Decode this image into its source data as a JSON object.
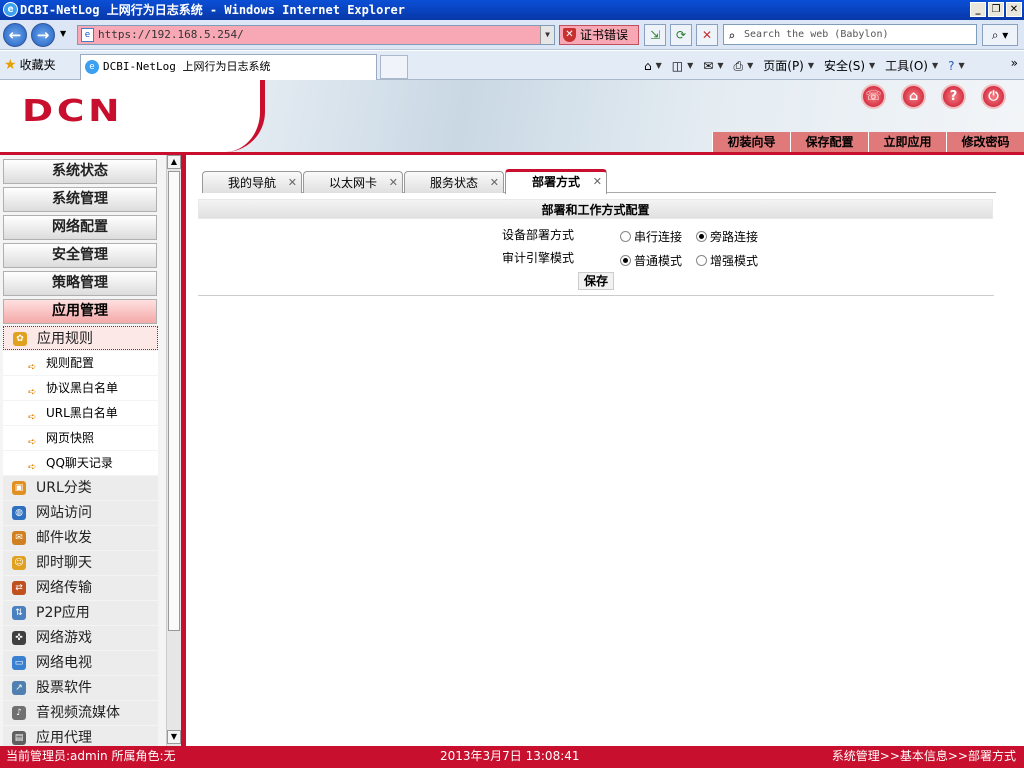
{
  "window": {
    "title": "DCBI-NetLog 上网行为日志系统 - Windows Internet Explorer"
  },
  "browser": {
    "address": "https://192.168.5.254/",
    "cert_error": "证书错误",
    "search_placeholder": "Search the web (Babylon)",
    "favorites": "收藏夹",
    "tab_title": "DCBI-NetLog 上网行为日志系统",
    "cmd": {
      "page": "页面(P)",
      "safety": "安全(S)",
      "tools": "工具(O)"
    }
  },
  "header": {
    "logo": "DCN",
    "menu": [
      "初装向导",
      "保存配置",
      "立即应用",
      "修改密码"
    ]
  },
  "sidebar": {
    "categories": [
      "系统状态",
      "系统管理",
      "网络配置",
      "安全管理",
      "策略管理",
      "应用管理"
    ],
    "active_sub": "应用规则",
    "leaves": [
      "规则配置",
      "协议黑白名单",
      "URL黑白名单",
      "网页快照",
      "QQ聊天记录"
    ],
    "subs": [
      "URL分类",
      "网站访问",
      "邮件收发",
      "即时聊天",
      "网络传输",
      "P2P应用",
      "网络游戏",
      "网络电视",
      "股票软件",
      "音视频流媒体",
      "应用代理"
    ]
  },
  "tabs": [
    {
      "label": "我的导航",
      "active": false
    },
    {
      "label": "以太网卡",
      "active": false
    },
    {
      "label": "服务状态",
      "active": false
    },
    {
      "label": "部署方式",
      "active": true
    }
  ],
  "panel": {
    "title": "部署和工作方式配置",
    "deploy_label": "设备部署方式",
    "deploy_options": [
      "串行连接",
      "旁路连接"
    ],
    "deploy_selected": "旁路连接",
    "engine_label": "审计引擎模式",
    "engine_options": [
      "普通模式",
      "增强模式"
    ],
    "engine_selected": "普通模式",
    "save": "保存"
  },
  "status": {
    "admin": "当前管理员:admin  所属角色:无",
    "datetime": "2013年3月7日 13:08:41",
    "breadcrumb": "系统管理>>基本信息>>部署方式"
  }
}
